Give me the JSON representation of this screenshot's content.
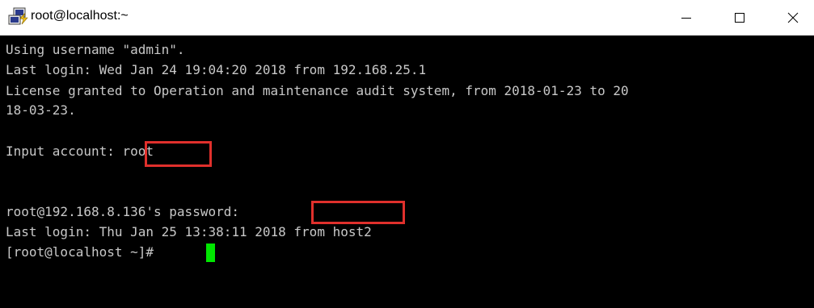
{
  "window": {
    "title": "root@localhost:~",
    "icon": "putty-icon",
    "controls": {
      "minimize": "minimize-icon",
      "maximize": "maximize-icon",
      "close": "close-icon"
    }
  },
  "terminal": {
    "lines": [
      "Using username \"admin\".",
      "Last login: Wed Jan 24 19:04:20 2018 from 192.168.25.1",
      "License granted to Operation and maintenance audit system, from 2018-01-23 to 20",
      "18-03-23.",
      "",
      "Input account: root",
      "",
      "",
      "root@192.168.8.136's password: ",
      "Last login: Thu Jan 25 13:38:11 2018 from host2",
      "[root@localhost ~]# "
    ]
  },
  "colors": {
    "terminal_background": "#000000",
    "terminal_text": "#c8c8c8",
    "cursor": "#00e600",
    "highlight_box": "#e0302c"
  }
}
